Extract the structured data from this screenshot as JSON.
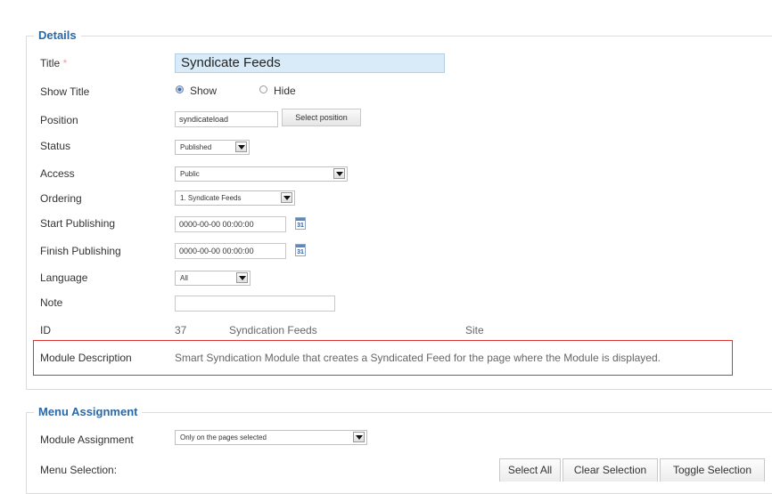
{
  "details": {
    "legend": "Details",
    "title_label": "Title",
    "required_mark": "*",
    "title_value": "Syndicate Feeds",
    "show_title_label": "Show Title",
    "show_title_options": [
      "Show",
      "Hide"
    ],
    "show_title_selected": "Show",
    "position_label": "Position",
    "position_value": "syndicateload",
    "select_position_button": "Select position",
    "status_label": "Status",
    "status_value": "Published",
    "access_label": "Access",
    "access_value": "Public",
    "ordering_label": "Ordering",
    "ordering_value": "1. Syndicate Feeds",
    "start_publishing_label": "Start Publishing",
    "start_publishing_value": "0000-00-00 00:00:00",
    "finish_publishing_label": "Finish Publishing",
    "finish_publishing_value": "0000-00-00 00:00:00",
    "calendar_day": "31",
    "language_label": "Language",
    "language_value": "All",
    "note_label": "Note",
    "note_value": "",
    "id_label": "ID",
    "id_value": "37",
    "id_module_name": "Syndication Feeds",
    "id_client": "Site",
    "module_description_label": "Module Description",
    "module_description_value": "Smart Syndication Module that creates a Syndicated Feed for the page where the Module is displayed."
  },
  "menu_assignment": {
    "legend": "Menu Assignment",
    "module_assignment_label": "Module Assignment",
    "module_assignment_value": "Only on the pages selected",
    "menu_selection_label": "Menu Selection:",
    "select_all_button": "Select All",
    "clear_selection_button": "Clear Selection",
    "toggle_selection_button": "Toggle Selection"
  },
  "colors": {
    "legend": "#2a68a8",
    "title_field_bg": "#d9ebf8",
    "highlight_border": "#dd3333",
    "required_mark": "#e8a0a0"
  },
  "icons": [
    "calendar-icon",
    "dropdown-arrow-icon",
    "radio-icon"
  ]
}
